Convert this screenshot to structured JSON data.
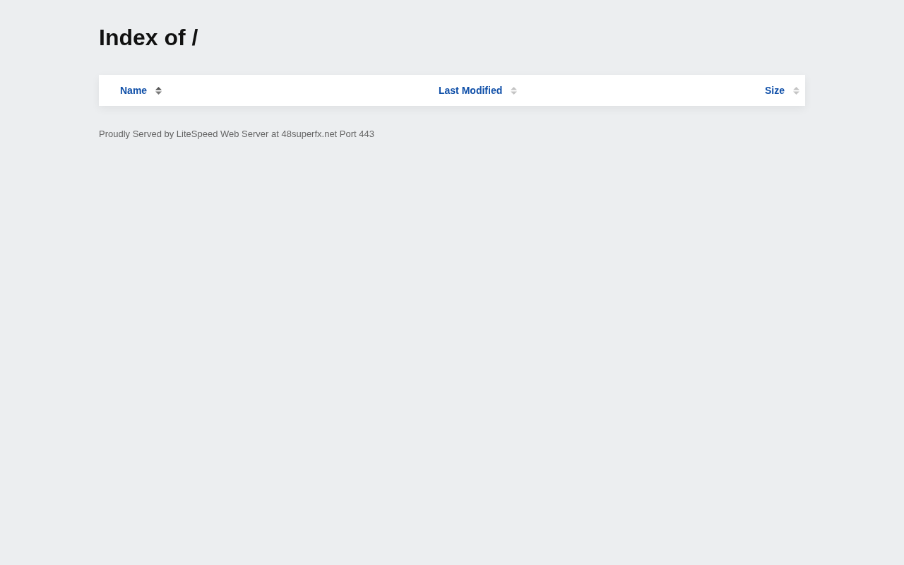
{
  "title": "Index of /",
  "table": {
    "columns": [
      {
        "label": "Name",
        "selected": true
      },
      {
        "label": "Last Modified",
        "selected": false
      },
      {
        "label": "Size",
        "selected": false
      }
    ]
  },
  "footer": "Proudly Served by LiteSpeed Web Server at 48superfx.net Port 443"
}
